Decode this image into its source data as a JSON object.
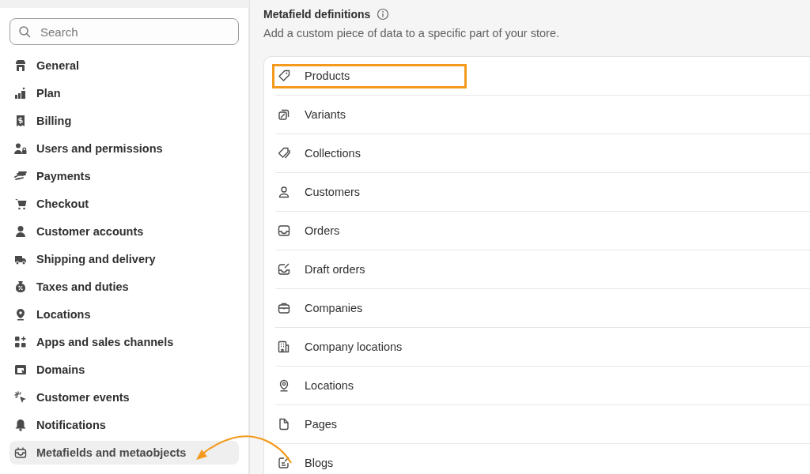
{
  "sidebar": {
    "search": {
      "placeholder": "Search"
    },
    "items": [
      {
        "label": "General",
        "selected": false
      },
      {
        "label": "Plan",
        "selected": false
      },
      {
        "label": "Billing",
        "selected": false
      },
      {
        "label": "Users and permissions",
        "selected": false
      },
      {
        "label": "Payments",
        "selected": false
      },
      {
        "label": "Checkout",
        "selected": false
      },
      {
        "label": "Customer accounts",
        "selected": false
      },
      {
        "label": "Shipping and delivery",
        "selected": false
      },
      {
        "label": "Taxes and duties",
        "selected": false
      },
      {
        "label": "Locations",
        "selected": false
      },
      {
        "label": "Apps and sales channels",
        "selected": false
      },
      {
        "label": "Domains",
        "selected": false
      },
      {
        "label": "Customer events",
        "selected": false
      },
      {
        "label": "Notifications",
        "selected": false
      },
      {
        "label": "Metafields and metaobjects",
        "selected": true
      }
    ]
  },
  "section": {
    "title": "Metafield definitions",
    "description": "Add a custom piece of data to a specific part of your store.",
    "rows": [
      {
        "label": "Products",
        "highlighted": true
      },
      {
        "label": "Variants",
        "highlighted": false
      },
      {
        "label": "Collections",
        "highlighted": false
      },
      {
        "label": "Customers",
        "highlighted": false
      },
      {
        "label": "Orders",
        "highlighted": false
      },
      {
        "label": "Draft orders",
        "highlighted": false
      },
      {
        "label": "Companies",
        "highlighted": false
      },
      {
        "label": "Company locations",
        "highlighted": false
      },
      {
        "label": "Locations",
        "highlighted": false
      },
      {
        "label": "Pages",
        "highlighted": false
      },
      {
        "label": "Blogs",
        "highlighted": false
      }
    ]
  }
}
